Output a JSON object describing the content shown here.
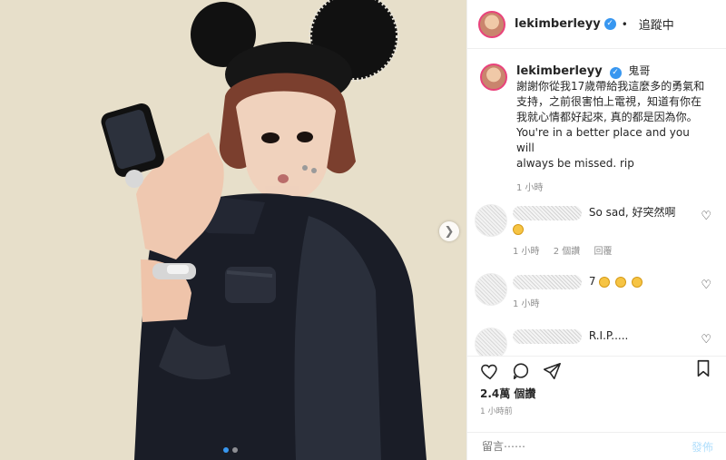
{
  "post": {
    "username": "lekimberleyy",
    "verified_icon": "✓",
    "follow_status": "追蹤中",
    "caption_lines": [
      "鬼哥",
      "謝謝你從我17歲帶給我這麼多的勇氣和",
      "支持，之前很害怕上電視，知道有你在",
      "我就心情都好起來, 真的都是因為你。",
      "You're in a better place and you will",
      "always be missed. rip"
    ],
    "caption_time": "1 小時"
  },
  "comments": [
    {
      "text": "So sad, 好突然啊",
      "time": "1 小時",
      "likes": "2 個讚",
      "reply": "回覆"
    },
    {
      "text": "7",
      "time": "1 小時",
      "likes": "",
      "reply": ""
    },
    {
      "text": "R.I.P.....",
      "time": "",
      "likes": "",
      "reply": ""
    }
  ],
  "actions": {
    "likes_count": "2.4萬 個讚",
    "time_ago": "1 小時前"
  },
  "composer": {
    "placeholder": "留言⋯⋯",
    "send_label": "發佈"
  },
  "media": {
    "next_icon": "chevron-right-icon",
    "next_glyph": "❯"
  }
}
